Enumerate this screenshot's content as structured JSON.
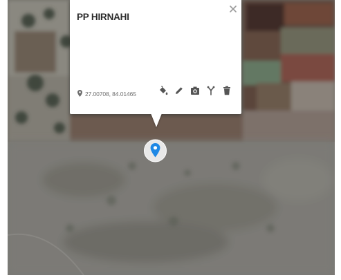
{
  "map": {
    "style": "satellite",
    "colors": {
      "cropland_dark": "#3d2c26",
      "cropland_red": "#6e4638",
      "field_green": "#5c7357",
      "haze_gray": "#7b7a76",
      "bush": "#4f5448"
    }
  },
  "popup": {
    "title": "PP HIRNAHI",
    "coordinates": "27.00708, 84.01465",
    "icons": {
      "close": "close-icon",
      "location": "location-pin-icon",
      "actions": [
        "paint-bucket-icon",
        "pencil-icon",
        "camera-icon",
        "route-fork-icon",
        "trash-icon"
      ]
    }
  },
  "marker": {
    "icon": "map-marker-icon",
    "color": "#1e88e5"
  }
}
